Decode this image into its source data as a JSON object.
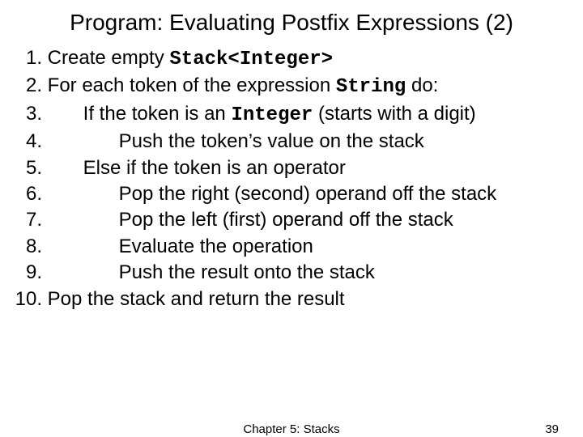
{
  "title": "Program: Evaluating Postfix Expressions (2)",
  "lines": {
    "n1": "1.",
    "n2": "2.",
    "n3": "3.",
    "n4": "4.",
    "n5": "5.",
    "n6": "6.",
    "n7": "7.",
    "n8": "8.",
    "n9": "9.",
    "n10": "10.",
    "t1a": " Create empty ",
    "t1b": "Stack<Integer>",
    "t2a": " For each token of the expression ",
    "t2b": "String",
    "t2c": " do:",
    "t3a": "If the token is an ",
    "t3b": "Integer",
    "t3c": " (starts with a digit)",
    "t4": "Push the token’s value on the stack",
    "t5": "Else if the token is an operator",
    "t6": "Pop the right (second) operand off the stack",
    "t7": "Pop the left (first) operand off the stack",
    "t8": "Evaluate the operation",
    "t9": "Push the result onto the stack",
    "t10": " Pop the stack and return the result"
  },
  "footer": {
    "center": "Chapter 5: Stacks",
    "page": "39"
  }
}
